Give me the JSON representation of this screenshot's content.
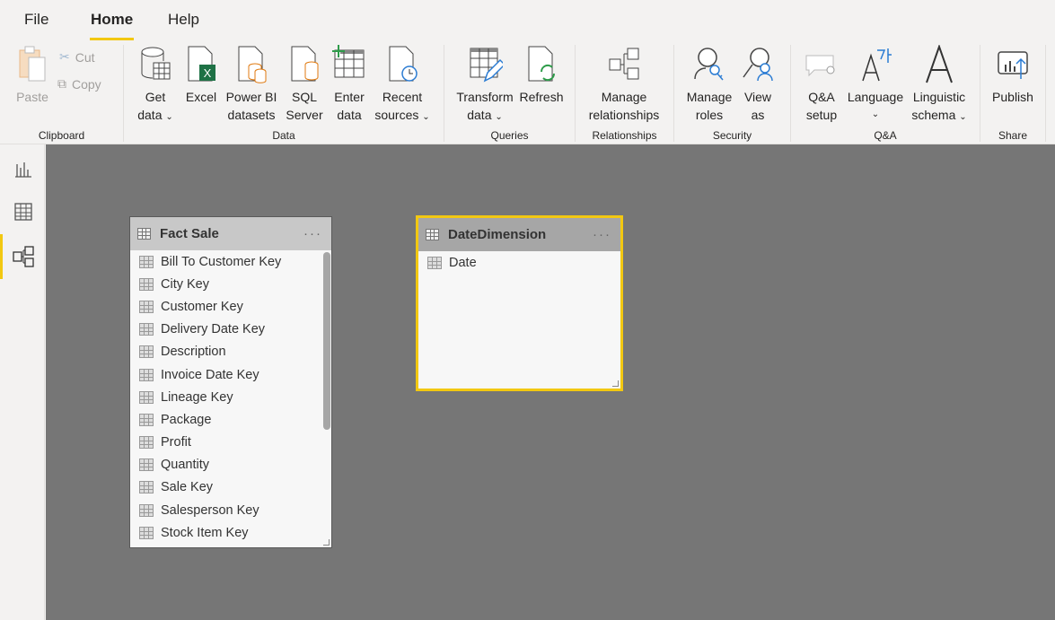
{
  "tabs": [
    {
      "label": "File"
    },
    {
      "label": "Home"
    },
    {
      "label": "Help"
    }
  ],
  "ribbon": {
    "clipboard": {
      "paste": "Paste",
      "cut": "Cut",
      "copy": "Copy",
      "group": "Clipboard"
    },
    "data": {
      "get_data_1": "Get",
      "get_data_2": "data",
      "excel": "Excel",
      "pbi_1": "Power BI",
      "pbi_2": "datasets",
      "sql_1": "SQL",
      "sql_2": "Server",
      "enter_1": "Enter",
      "enter_2": "data",
      "recent_1": "Recent",
      "recent_2": "sources",
      "group": "Data"
    },
    "queries": {
      "transform_1": "Transform",
      "transform_2": "data",
      "refresh": "Refresh",
      "group": "Queries"
    },
    "relationships": {
      "manage_1": "Manage",
      "manage_2": "relationships",
      "group": "Relationships"
    },
    "security": {
      "roles_1": "Manage",
      "roles_2": "roles",
      "view_1": "View",
      "view_2": "as",
      "group": "Security"
    },
    "qa": {
      "setup_1": "Q&A",
      "setup_2": "setup",
      "language": "Language",
      "ling_1": "Linguistic",
      "ling_2": "schema",
      "group": "Q&A"
    },
    "share": {
      "publish": "Publish",
      "group": "Share"
    },
    "chevron": "⌄"
  },
  "tables": [
    {
      "name": "Fact Sale",
      "fields": [
        "Bill To Customer Key",
        "City Key",
        "Customer Key",
        "Delivery Date Key",
        "Description",
        "Invoice Date Key",
        "Lineage Key",
        "Package",
        "Profit",
        "Quantity",
        "Sale Key",
        "Salesperson Key",
        "Stock Item Key"
      ]
    },
    {
      "name": "DateDimension",
      "fields": [
        "Date"
      ]
    }
  ],
  "colors": {
    "accent": "#f2c811",
    "canvas": "#767676"
  }
}
